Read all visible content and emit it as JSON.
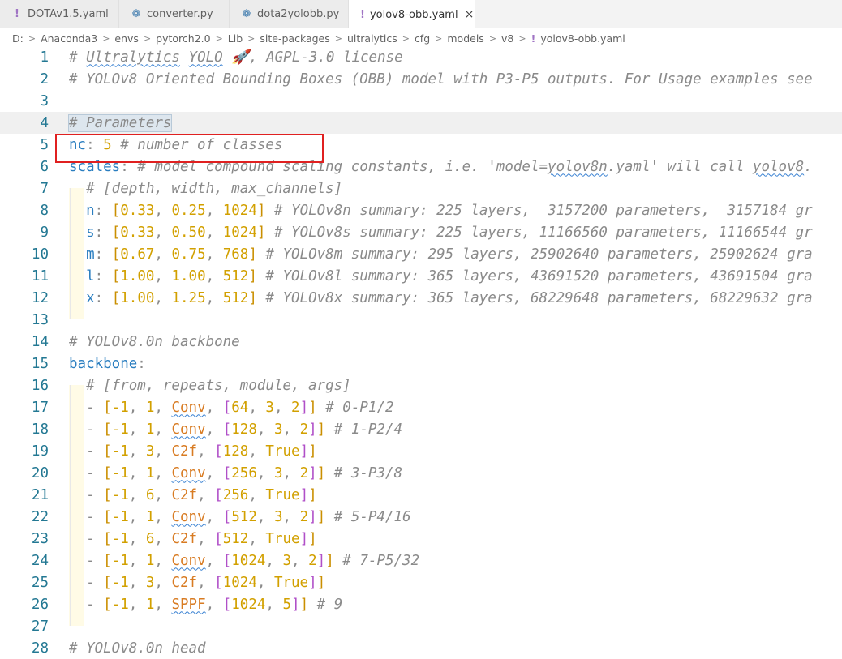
{
  "tabs": [
    {
      "label": "DOTAv1.5.yaml",
      "icon": "yaml-icon",
      "active": false
    },
    {
      "label": "converter.py",
      "icon": "python-icon",
      "active": false
    },
    {
      "label": "dota2yolobb.py",
      "icon": "python-icon",
      "active": false
    },
    {
      "label": "yolov8-obb.yaml",
      "icon": "yaml-icon",
      "active": true
    }
  ],
  "breadcrumb": [
    "D:",
    "Anaconda3",
    "envs",
    "pytorch2.0",
    "Lib",
    "site-packages",
    "ultralytics",
    "cfg",
    "models",
    "v8",
    "yolov8-obb.yaml"
  ],
  "icons": {
    "yaml": "!",
    "python": "❁",
    "close": "×",
    "rocket": "🚀",
    "chevron": "〉"
  },
  "highlight_color": "#e02020",
  "lines": [
    {
      "n": "1",
      "t": [
        [
          "c",
          "# "
        ],
        [
          "c sq",
          "Ultralytics"
        ],
        [
          "c",
          " "
        ],
        [
          "c sq",
          "YOLO"
        ],
        [
          "c",
          " 🚀, AGPL-3.0 license"
        ]
      ]
    },
    {
      "n": "2",
      "t": [
        [
          "c",
          "# YOLOv8 Oriented Bounding Boxes (OBB) model with P3-P5 outputs. For Usage examples see"
        ]
      ]
    },
    {
      "n": "3",
      "t": []
    },
    {
      "n": "4",
      "t": [
        [
          "c sel",
          "# Parameters"
        ]
      ]
    },
    {
      "n": "5",
      "t": [
        [
          "k",
          "nc"
        ],
        [
          "p",
          ": "
        ],
        [
          "n",
          "5"
        ],
        [
          "c",
          " # number of classes"
        ]
      ]
    },
    {
      "n": "6",
      "t": [
        [
          "k",
          "scales"
        ],
        [
          "p",
          ": "
        ],
        [
          "c",
          "# model compound scaling constants, i.e. 'model="
        ],
        [
          "c sq",
          "yolov8n"
        ],
        [
          "c",
          ".yaml' will call "
        ],
        [
          "c sq",
          "yolov8"
        ],
        [
          "c",
          "."
        ]
      ]
    },
    {
      "n": "7",
      "t": [
        [
          "p",
          "  "
        ],
        [
          "c",
          "# [depth, width, max_channels]"
        ]
      ]
    },
    {
      "n": "8",
      "t": [
        [
          "p",
          "  "
        ],
        [
          "k",
          "n"
        ],
        [
          "p",
          ": "
        ],
        [
          "b1",
          "["
        ],
        [
          "n",
          "0.33"
        ],
        [
          "p",
          ", "
        ],
        [
          "n",
          "0.25"
        ],
        [
          "p",
          ", "
        ],
        [
          "n",
          "1024"
        ],
        [
          "b1",
          "]"
        ],
        [
          "c",
          " # YOLOv8n summary: 225 layers,  3157200 parameters,  3157184 gr"
        ]
      ]
    },
    {
      "n": "9",
      "t": [
        [
          "p",
          "  "
        ],
        [
          "k",
          "s"
        ],
        [
          "p",
          ": "
        ],
        [
          "b1",
          "["
        ],
        [
          "n",
          "0.33"
        ],
        [
          "p",
          ", "
        ],
        [
          "n",
          "0.50"
        ],
        [
          "p",
          ", "
        ],
        [
          "n",
          "1024"
        ],
        [
          "b1",
          "]"
        ],
        [
          "c",
          " # YOLOv8s summary: 225 layers, 11166560 parameters, 11166544 gr"
        ]
      ]
    },
    {
      "n": "10",
      "t": [
        [
          "p",
          "  "
        ],
        [
          "k",
          "m"
        ],
        [
          "p",
          ": "
        ],
        [
          "b1",
          "["
        ],
        [
          "n",
          "0.67"
        ],
        [
          "p",
          ", "
        ],
        [
          "n",
          "0.75"
        ],
        [
          "p",
          ", "
        ],
        [
          "n",
          "768"
        ],
        [
          "b1",
          "]"
        ],
        [
          "c",
          " # YOLOv8m summary: 295 layers, 25902640 parameters, 25902624 gra"
        ]
      ]
    },
    {
      "n": "11",
      "t": [
        [
          "p",
          "  "
        ],
        [
          "k",
          "l"
        ],
        [
          "p",
          ": "
        ],
        [
          "b1",
          "["
        ],
        [
          "n",
          "1.00"
        ],
        [
          "p",
          ", "
        ],
        [
          "n",
          "1.00"
        ],
        [
          "p",
          ", "
        ],
        [
          "n",
          "512"
        ],
        [
          "b1",
          "]"
        ],
        [
          "c",
          " # YOLOv8l summary: 365 layers, 43691520 parameters, 43691504 gra"
        ]
      ]
    },
    {
      "n": "12",
      "t": [
        [
          "p",
          "  "
        ],
        [
          "k",
          "x"
        ],
        [
          "p",
          ": "
        ],
        [
          "b1",
          "["
        ],
        [
          "n",
          "1.00"
        ],
        [
          "p",
          ", "
        ],
        [
          "n",
          "1.25"
        ],
        [
          "p",
          ", "
        ],
        [
          "n",
          "512"
        ],
        [
          "b1",
          "]"
        ],
        [
          "c",
          " # YOLOv8x summary: 365 layers, 68229648 parameters, 68229632 gra"
        ]
      ]
    },
    {
      "n": "13",
      "t": []
    },
    {
      "n": "14",
      "t": [
        [
          "c",
          "# YOLOv8.0n backbone"
        ]
      ]
    },
    {
      "n": "15",
      "t": [
        [
          "k",
          "backbone"
        ],
        [
          "p",
          ":"
        ]
      ]
    },
    {
      "n": "16",
      "t": [
        [
          "p",
          "  "
        ],
        [
          "c",
          "# [from, repeats, module, args]"
        ]
      ]
    },
    {
      "n": "17",
      "t": [
        [
          "p",
          "  - "
        ],
        [
          "b1",
          "["
        ],
        [
          "n",
          "-1"
        ],
        [
          "p",
          ", "
        ],
        [
          "n",
          "1"
        ],
        [
          "p",
          ", "
        ],
        [
          "s sq",
          "Conv"
        ],
        [
          "p",
          ", "
        ],
        [
          "b2",
          "["
        ],
        [
          "n",
          "64"
        ],
        [
          "p",
          ", "
        ],
        [
          "n",
          "3"
        ],
        [
          "p",
          ", "
        ],
        [
          "n",
          "2"
        ],
        [
          "b2",
          "]"
        ],
        [
          "b1",
          "]"
        ],
        [
          "c",
          " # 0-P1/2"
        ]
      ]
    },
    {
      "n": "18",
      "t": [
        [
          "p",
          "  - "
        ],
        [
          "b1",
          "["
        ],
        [
          "n",
          "-1"
        ],
        [
          "p",
          ", "
        ],
        [
          "n",
          "1"
        ],
        [
          "p",
          ", "
        ],
        [
          "s sq",
          "Conv"
        ],
        [
          "p",
          ", "
        ],
        [
          "b2",
          "["
        ],
        [
          "n",
          "128"
        ],
        [
          "p",
          ", "
        ],
        [
          "n",
          "3"
        ],
        [
          "p",
          ", "
        ],
        [
          "n",
          "2"
        ],
        [
          "b2",
          "]"
        ],
        [
          "b1",
          "]"
        ],
        [
          "c",
          " # 1-P2/4"
        ]
      ]
    },
    {
      "n": "19",
      "t": [
        [
          "p",
          "  - "
        ],
        [
          "b1",
          "["
        ],
        [
          "n",
          "-1"
        ],
        [
          "p",
          ", "
        ],
        [
          "n",
          "3"
        ],
        [
          "p",
          ", "
        ],
        [
          "s",
          "C2f"
        ],
        [
          "p",
          ", "
        ],
        [
          "b2",
          "["
        ],
        [
          "n",
          "128"
        ],
        [
          "p",
          ", "
        ],
        [
          "n",
          "True"
        ],
        [
          "b2",
          "]"
        ],
        [
          "b1",
          "]"
        ]
      ]
    },
    {
      "n": "20",
      "t": [
        [
          "p",
          "  - "
        ],
        [
          "b1",
          "["
        ],
        [
          "n",
          "-1"
        ],
        [
          "p",
          ", "
        ],
        [
          "n",
          "1"
        ],
        [
          "p",
          ", "
        ],
        [
          "s sq",
          "Conv"
        ],
        [
          "p",
          ", "
        ],
        [
          "b2",
          "["
        ],
        [
          "n",
          "256"
        ],
        [
          "p",
          ", "
        ],
        [
          "n",
          "3"
        ],
        [
          "p",
          ", "
        ],
        [
          "n",
          "2"
        ],
        [
          "b2",
          "]"
        ],
        [
          "b1",
          "]"
        ],
        [
          "c",
          " # 3-P3/8"
        ]
      ]
    },
    {
      "n": "21",
      "t": [
        [
          "p",
          "  - "
        ],
        [
          "b1",
          "["
        ],
        [
          "n",
          "-1"
        ],
        [
          "p",
          ", "
        ],
        [
          "n",
          "6"
        ],
        [
          "p",
          ", "
        ],
        [
          "s",
          "C2f"
        ],
        [
          "p",
          ", "
        ],
        [
          "b2",
          "["
        ],
        [
          "n",
          "256"
        ],
        [
          "p",
          ", "
        ],
        [
          "n",
          "True"
        ],
        [
          "b2",
          "]"
        ],
        [
          "b1",
          "]"
        ]
      ]
    },
    {
      "n": "22",
      "t": [
        [
          "p",
          "  - "
        ],
        [
          "b1",
          "["
        ],
        [
          "n",
          "-1"
        ],
        [
          "p",
          ", "
        ],
        [
          "n",
          "1"
        ],
        [
          "p",
          ", "
        ],
        [
          "s sq",
          "Conv"
        ],
        [
          "p",
          ", "
        ],
        [
          "b2",
          "["
        ],
        [
          "n",
          "512"
        ],
        [
          "p",
          ", "
        ],
        [
          "n",
          "3"
        ],
        [
          "p",
          ", "
        ],
        [
          "n",
          "2"
        ],
        [
          "b2",
          "]"
        ],
        [
          "b1",
          "]"
        ],
        [
          "c",
          " # 5-P4/16"
        ]
      ]
    },
    {
      "n": "23",
      "t": [
        [
          "p",
          "  - "
        ],
        [
          "b1",
          "["
        ],
        [
          "n",
          "-1"
        ],
        [
          "p",
          ", "
        ],
        [
          "n",
          "6"
        ],
        [
          "p",
          ", "
        ],
        [
          "s",
          "C2f"
        ],
        [
          "p",
          ", "
        ],
        [
          "b2",
          "["
        ],
        [
          "n",
          "512"
        ],
        [
          "p",
          ", "
        ],
        [
          "n",
          "True"
        ],
        [
          "b2",
          "]"
        ],
        [
          "b1",
          "]"
        ]
      ]
    },
    {
      "n": "24",
      "t": [
        [
          "p",
          "  - "
        ],
        [
          "b1",
          "["
        ],
        [
          "n",
          "-1"
        ],
        [
          "p",
          ", "
        ],
        [
          "n",
          "1"
        ],
        [
          "p",
          ", "
        ],
        [
          "s sq",
          "Conv"
        ],
        [
          "p",
          ", "
        ],
        [
          "b2",
          "["
        ],
        [
          "n",
          "1024"
        ],
        [
          "p",
          ", "
        ],
        [
          "n",
          "3"
        ],
        [
          "p",
          ", "
        ],
        [
          "n",
          "2"
        ],
        [
          "b2",
          "]"
        ],
        [
          "b1",
          "]"
        ],
        [
          "c",
          " # 7-P5/32"
        ]
      ]
    },
    {
      "n": "25",
      "t": [
        [
          "p",
          "  - "
        ],
        [
          "b1",
          "["
        ],
        [
          "n",
          "-1"
        ],
        [
          "p",
          ", "
        ],
        [
          "n",
          "3"
        ],
        [
          "p",
          ", "
        ],
        [
          "s",
          "C2f"
        ],
        [
          "p",
          ", "
        ],
        [
          "b2",
          "["
        ],
        [
          "n",
          "1024"
        ],
        [
          "p",
          ", "
        ],
        [
          "n",
          "True"
        ],
        [
          "b2",
          "]"
        ],
        [
          "b1",
          "]"
        ]
      ]
    },
    {
      "n": "26",
      "t": [
        [
          "p",
          "  - "
        ],
        [
          "b1",
          "["
        ],
        [
          "n",
          "-1"
        ],
        [
          "p",
          ", "
        ],
        [
          "n",
          "1"
        ],
        [
          "p",
          ", "
        ],
        [
          "s sq",
          "SPPF"
        ],
        [
          "p",
          ", "
        ],
        [
          "b2",
          "["
        ],
        [
          "n",
          "1024"
        ],
        [
          "p",
          ", "
        ],
        [
          "n",
          "5"
        ],
        [
          "b2",
          "]"
        ],
        [
          "b1",
          "]"
        ],
        [
          "c",
          " # 9"
        ]
      ]
    },
    {
      "n": "27",
      "t": []
    },
    {
      "n": "28",
      "t": [
        [
          "c",
          "# YOLOv8.0n head"
        ]
      ]
    }
  ]
}
